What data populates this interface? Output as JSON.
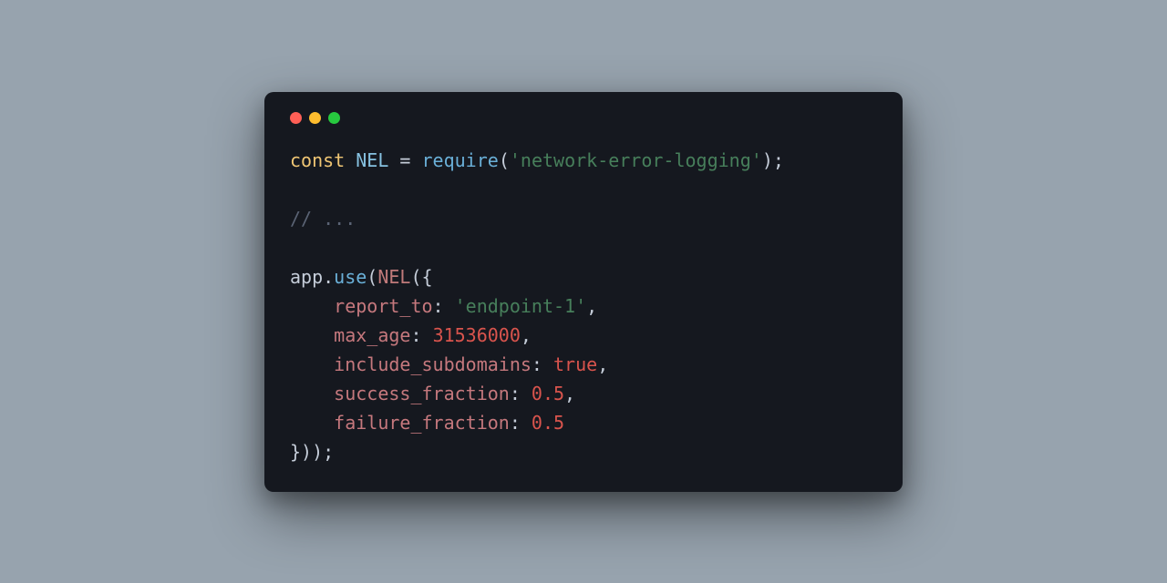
{
  "code": {
    "tokens": {
      "const_kw": "const",
      "nel_const": "NEL",
      "equals": " = ",
      "require_fn": "require",
      "lparen": "(",
      "module_str": "'network-error-logging'",
      "rparen_semi": ");",
      "comment": "// ...",
      "app_ident": "app",
      "dot": ".",
      "use_fn": "use",
      "nel_call": "NEL",
      "open_obj": "({",
      "key_report_to": "report_to",
      "colon_sp": ": ",
      "val_report_to": "'endpoint-1'",
      "comma": ",",
      "key_max_age": "max_age",
      "val_max_age": "31536000",
      "key_include": "include_subdomains",
      "val_include": "true",
      "key_success": "success_fraction",
      "val_success": "0.5",
      "key_failure": "failure_fraction",
      "val_failure": "0.5",
      "close_obj": "}));",
      "indent": "    "
    }
  }
}
